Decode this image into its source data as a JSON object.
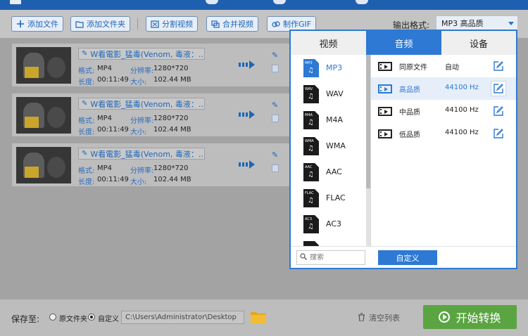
{
  "toolbar": {
    "add_file": "添加文件",
    "add_folder": "添加文件夹",
    "split_video": "分割视频",
    "merge_video": "合并视频",
    "make_gif": "制作GIF",
    "output_format_label": "输出格式:",
    "output_format_value": "MP3  高品质"
  },
  "files": [
    {
      "name": "W看電影_猛毒(Venom, 毒液：...",
      "format_label": "格式:",
      "format": "MP4",
      "resolution_label": "分辨率:",
      "resolution": "1280*720",
      "duration_label": "长度:",
      "duration": "00:11:49",
      "size_label": "大小:",
      "size": "102.44 MB"
    },
    {
      "name": "W看電影_猛毒(Venom, 毒液：...",
      "format_label": "格式:",
      "format": "MP4",
      "resolution_label": "分辨率:",
      "resolution": "1280*720",
      "duration_label": "长度:",
      "duration": "00:11:49",
      "size_label": "大小:",
      "size": "102.44 MB"
    },
    {
      "name": "W看電影_猛毒(Venom, 毒液：...",
      "format_label": "格式:",
      "format": "MP4",
      "resolution_label": "分辨率:",
      "resolution": "1280*720",
      "duration_label": "长度:",
      "duration": "00:11:49",
      "size_label": "大小:",
      "size": "102.44 MB"
    }
  ],
  "popup": {
    "tabs": [
      "视频",
      "音频",
      "设备"
    ],
    "active_tab": "音频",
    "formats": [
      {
        "name": "MP3",
        "tag": "MP3",
        "active": true
      },
      {
        "name": "WAV",
        "tag": "WAV",
        "active": false
      },
      {
        "name": "M4A",
        "tag": "M4A",
        "active": false
      },
      {
        "name": "WMA",
        "tag": "WMA",
        "active": false
      },
      {
        "name": "AAC",
        "tag": "AAC",
        "active": false
      },
      {
        "name": "FLAC",
        "tag": "FLAC",
        "active": false
      },
      {
        "name": "AC3",
        "tag": "AC3",
        "active": false
      }
    ],
    "qualities": [
      {
        "name": "同原文件",
        "rate": "自动",
        "active": false
      },
      {
        "name": "高品质",
        "rate": "44100 Hz",
        "active": true
      },
      {
        "name": "中品质",
        "rate": "44100 Hz",
        "active": false
      },
      {
        "name": "低品质",
        "rate": "44100 Hz",
        "active": false
      }
    ],
    "search_placeholder": "搜索",
    "custom_button": "自定义"
  },
  "bottom": {
    "save_to_label": "保存至:",
    "option_source": "原文件夹",
    "option_custom": "自定义",
    "path": "C:\\Users\\Administrator\\Desktop",
    "clear_list": "清空列表",
    "start": "开始转换"
  },
  "colors": {
    "accent": "#2d79d3",
    "start_button": "#5aa541"
  }
}
